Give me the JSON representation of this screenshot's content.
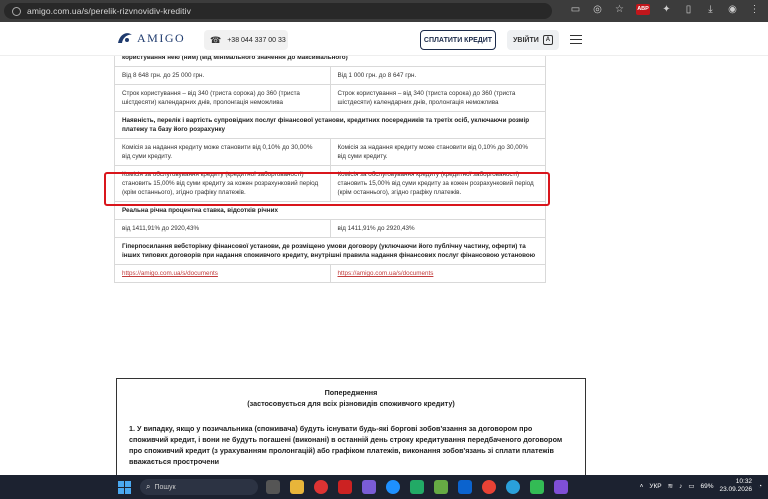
{
  "browser": {
    "url": "amigo.com.ua/s/perelik-rizvnovidiv-kreditiv",
    "extension_badge": "ABP"
  },
  "header": {
    "logo_text": "AMIGO",
    "phone": "+38 044 337 00 33",
    "pay_button": "СПЛАТИТИ КРЕДИТ",
    "login_button": "УВІЙТИ"
  },
  "table": {
    "rows": [
      {
        "type": "full",
        "text": "користування нею (ним) (від мінімального значення до максимального)"
      },
      {
        "type": "split",
        "left": "Від 8 648 грн. до 25 000 грн.",
        "right": "Від 1 000 грн. до 8 647 грн."
      },
      {
        "type": "split",
        "left": "Строк користування – від 340 (триста сорока) до 360 (триста шістдесяти) календарних днів, пролонгація неможлива",
        "right": "Строк користування – від 340 (триста сорока) до 360 (триста шістдесяти) календарних днів, пролонгація неможлива"
      },
      {
        "type": "full",
        "text": "Наявність, перелік і вартість супровідних послуг фінансової установи, кредитних посередників та третіх осіб, уключаючи розмір платежу та базу його розрахунку"
      },
      {
        "type": "split",
        "left": "Комісія за надання кредиту може становити від 0,10% до 30,00% від суми кредиту.",
        "right": "Комісія за надання кредиту може становити від 0,10% до 30,00% від суми кредиту."
      },
      {
        "type": "split",
        "left": "Комісія за обслуговування кредиту (кредитної заборгованості) становить 15,00% від суми кредиту за кожен розрахунковий період (крім останнього), згідно графіку платежів.",
        "right": "Комісія за обслуговування кредиту (кредитної заборгованості) становить 15,00% від суми кредиту за кожен розрахунковий період (крім останнього), згідно графіку платежів."
      },
      {
        "type": "full",
        "text": "Реальна річна процентна ставка, відсотків річних"
      },
      {
        "type": "split",
        "left": "від 1411,91% до 2920,43%",
        "right": "від 1411,91% до 2920,43%"
      },
      {
        "type": "full",
        "text": "Гіперпосилання вебсторінку фінансової установи, де розміщено умови договору (уключаючи його публічну частину, оферти) та інших типових договорів при надання споживчого кредиту, внутрішні правила надання фінансових послуг фінансовою установою"
      },
      {
        "type": "link",
        "left": "https://amigo.com.ua/s/documents",
        "right": "https://amigo.com.ua/s/documents"
      }
    ]
  },
  "warning": {
    "title": "Попередження",
    "subtitle": "(застосовується для всіх різновидів споживчого кредиту)",
    "text": "1. У випадку, якщо у позичальника (споживача) будуть існувати будь-які боргові зобов'язання за договором про споживчий кредит, і вони не будуть погашені (виконані) в останній день строку кредитування передбаченого договором про споживчий кредит (з урахуванням пролонгацій) або графіком платежів, виконання зобов'язань зі сплати платежів вважається прострочени"
  },
  "taskbar": {
    "search_placeholder": "Пошук",
    "language": "УКР",
    "battery": "69%",
    "time": "10:32",
    "date": "23.09.2026"
  },
  "colors": {
    "highlight": "#d9161c",
    "link": "#c23b3b",
    "brand": "#1f3b6e"
  }
}
